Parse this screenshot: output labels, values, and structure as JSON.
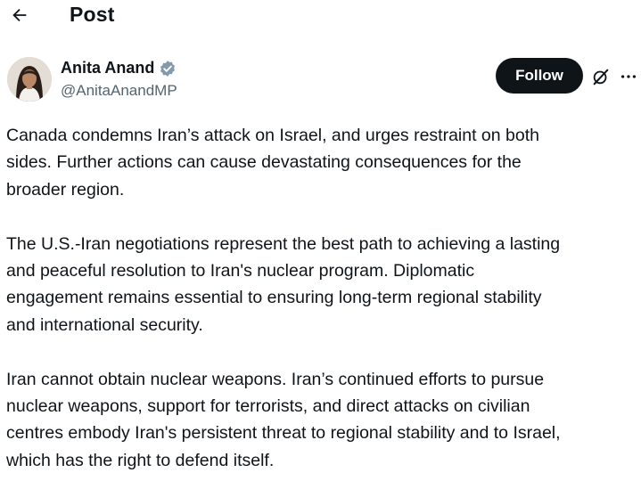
{
  "header": {
    "title": "Post",
    "back_icon": "arrow-left-icon"
  },
  "author": {
    "name": "Anita Anand",
    "handle": "@AnitaAnandMP",
    "verified_icon": "verified-badge-icon",
    "badge_color": "#829aab"
  },
  "actions": {
    "follow_label": "Follow",
    "grok_icon": "grok-icon",
    "more_icon": "more-dots-icon"
  },
  "post": {
    "paragraphs": [
      {
        "lines": [
          "Canada condemns Iran’s attack on Israel, and urges restraint on both",
          "sides. Further actions can cause devastating consequences for the",
          "broader region."
        ]
      },
      {
        "lines": [
          "The U.S.-Iran negotiations represent the best path to achieving a lasting",
          "and peaceful resolution to Iran's nuclear program. Diplomatic",
          "engagement remains essential to ensuring long-term regional stability",
          "and international security."
        ]
      },
      {
        "lines": [
          "Iran cannot obtain nuclear weapons. Iran’s continued efforts to pursue",
          "nuclear weapons, support for terrorists, and direct attacks on civilian",
          "centres embody Iran's persistent threat to regional stability and to Israel,",
          "which has the right to defend itself."
        ]
      }
    ]
  },
  "colors": {
    "text": "#0f1419",
    "secondary_text": "#536471",
    "follow_bg": "#0f1419",
    "follow_text": "#ffffff"
  }
}
